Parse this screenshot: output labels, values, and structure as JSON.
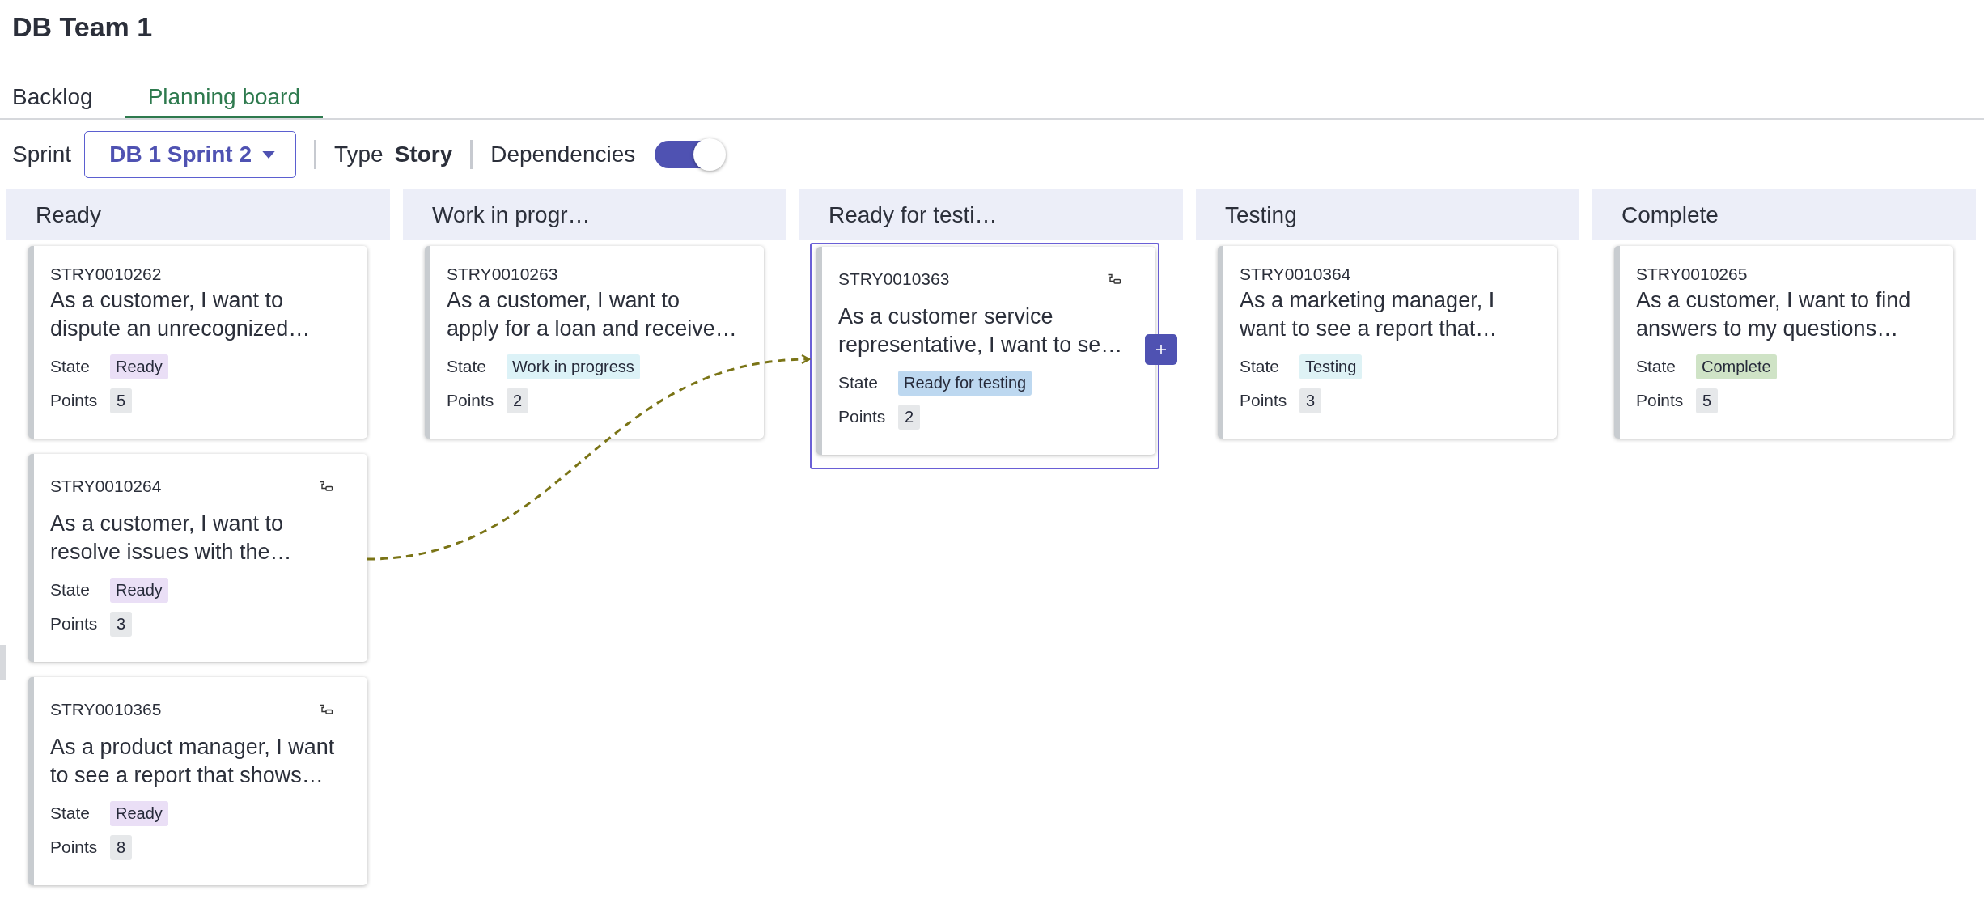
{
  "title": "DB Team 1",
  "tabs": [
    {
      "label": "Backlog",
      "selected": false
    },
    {
      "label": "Planning board",
      "selected": true
    }
  ],
  "toolbar": {
    "sprint_label": "Sprint",
    "sprint_value": "DB 1 Sprint 2",
    "type_label": "Type",
    "type_value": "Story",
    "dependencies_label": "Dependencies",
    "dependencies_on": true
  },
  "columns": [
    {
      "title": "Ready",
      "cards": [
        {
          "id": "STRY0010262",
          "title": "As a customer, I want to\ndispute an unrecognized…",
          "state_label": "State",
          "state": "Ready",
          "color": "#eadff6",
          "points_label": "Points",
          "points": "5",
          "dependency": false,
          "selected": false
        },
        {
          "id": "STRY0010264",
          "title": "As a customer, I want to\nresolve issues with the…",
          "state_label": "State",
          "state": "Ready",
          "color": "#eadff6",
          "points_label": "Points",
          "points": "3",
          "dependency": true,
          "selected": false
        },
        {
          "id": "STRY0010365",
          "title": "As a product manager, I want\nto see a report that shows…",
          "state_label": "State",
          "state": "Ready",
          "color": "#eadff6",
          "points_label": "Points",
          "points": "8",
          "dependency": true,
          "selected": false
        }
      ]
    },
    {
      "title": "Work in progr…",
      "cards": [
        {
          "id": "STRY0010263",
          "title": "As a customer, I want to\napply for a loan and receive…",
          "state_label": "State",
          "state": "Work in progress",
          "color": "#dcf2f7",
          "points_label": "Points",
          "points": "2",
          "dependency": false,
          "selected": false
        }
      ]
    },
    {
      "title": "Ready for testi…",
      "cards": [
        {
          "id": "STRY0010363",
          "title": "As a customer service\nrepresentative, I want to se…",
          "state_label": "State",
          "state": "Ready for testing",
          "color": "#bdd8f0",
          "points_label": "Points",
          "points": "2",
          "dependency": true,
          "selected": true
        }
      ]
    },
    {
      "title": "Testing",
      "cards": [
        {
          "id": "STRY0010364",
          "title": "As a marketing manager, I\nwant to see a report that…",
          "state_label": "State",
          "state": "Testing",
          "color": "#def2f5",
          "points_label": "Points",
          "points": "3",
          "dependency": false,
          "selected": false
        }
      ]
    },
    {
      "title": "Complete",
      "cards": [
        {
          "id": "STRY0010265",
          "title": "As a customer, I want to find\nanswers to my questions…",
          "state_label": "State",
          "state": "Complete",
          "color": "#cfe3c6",
          "points_label": "Points",
          "points": "5",
          "dependency": false,
          "selected": false
        }
      ]
    }
  ]
}
